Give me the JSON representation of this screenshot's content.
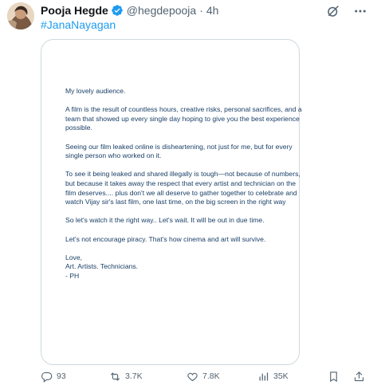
{
  "author": {
    "name": "Pooja Hegde",
    "handle": "@hegdepooja",
    "separator": "·",
    "time": "4h"
  },
  "post": {
    "hashtag": "#JanaNayagan"
  },
  "letter": {
    "salutation": "My lovely audience.",
    "paragraph_1": "A film is the result of countless hours, creative risks, personal sacrifices, and a team that showed up every single day hoping to give you the best experience possible.",
    "paragraph_2": "Seeing our film leaked online is disheartening, not just for me, but for every single person who worked on it.",
    "paragraph_3": "To see it being leaked and shared illegally is tough—not because of numbers, but because it takes away the respect that every artist and technician on the film deserves.... plus don't we all deserve to gather together to celebrate and watch Vijay sir's last film, one last time, on the big screen in the right way",
    "paragraph_4": "So let's watch it the right way.. Let's wait. It will be out in due time.",
    "paragraph_5": "Let's not encourage piracy. That's how cinema and art will survive.",
    "closing_1": "Love,",
    "closing_2": "Art. Artists. Technicians.",
    "closing_3": "- PH"
  },
  "actions": {
    "replies": "93",
    "reposts": "3.7K",
    "likes": "7.8K",
    "views": "35K"
  },
  "icons": {
    "verified": "verified-badge-icon",
    "grok": "grok-icon",
    "more": "more-icon",
    "reply": "reply-icon",
    "retweet": "retweet-icon",
    "like": "heart-icon",
    "views": "views-icon",
    "bookmark": "bookmark-icon",
    "share": "share-icon"
  },
  "colors": {
    "accent": "#1d9bf0",
    "secondary_text": "#536471",
    "letter_text": "#1a3f66"
  }
}
